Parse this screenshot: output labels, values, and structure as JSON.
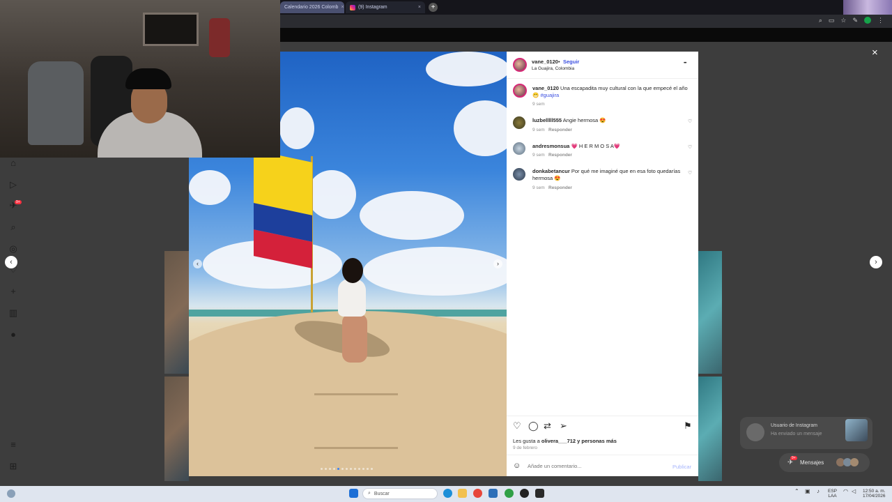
{
  "browser": {
    "tabs": [
      {
        "label": "Calendario 2026 Colomb"
      },
      {
        "label": "(9) Instagram"
      }
    ],
    "new_tab_glyph": "+",
    "close_glyph": "×"
  },
  "post": {
    "username": "vane_0120",
    "bullet": "•",
    "follow_label": "Seguir",
    "location": "La Guajira, Colombia",
    "more_glyph": "•••",
    "caption_user": "vane_0120",
    "caption_text": "Una escapadita muy cultural con la que empecé el año 😬",
    "caption_tag": "#guajira",
    "caption_time": "9 sem",
    "comments": [
      {
        "user": "luzbelllll555",
        "text": "Angie hermosa 😍",
        "time": "9 sem",
        "reply": "Responder"
      },
      {
        "user": "andresmonsua",
        "text": "💗 H E R M O S A💗",
        "time": "9 sem",
        "reply": "Responder"
      },
      {
        "user": "donkabetancur",
        "text": "Por qué me imaginé que en esa foto quedarías hermosa 😍",
        "time": "9 sem",
        "reply": "Responder"
      }
    ],
    "likes_prefix": "Les gusta a ",
    "likes_user": "olivera___712",
    "likes_suffix": " y personas más",
    "date": "9 de febrero",
    "comment_placeholder": "Añade un comentario...",
    "publish_label": "Publicar"
  },
  "sidebar": {
    "notification_badge": "9+"
  },
  "messages": {
    "preview_title": "Usuario de Instagram",
    "preview_text": "Ha enviado un mensaje",
    "pill_label": "Mensajes",
    "pill_badge": "9+"
  },
  "taskbar": {
    "search_placeholder": "Buscar",
    "lang_top": "ESP",
    "lang_bottom": "LAA",
    "time": "12:50 a. m.",
    "date": "17/04/2026"
  },
  "colors": {
    "accent_blue": "#3b4fe0",
    "instagram_ring": "#d62976",
    "modal_backdrop": "#3d3d3d"
  }
}
